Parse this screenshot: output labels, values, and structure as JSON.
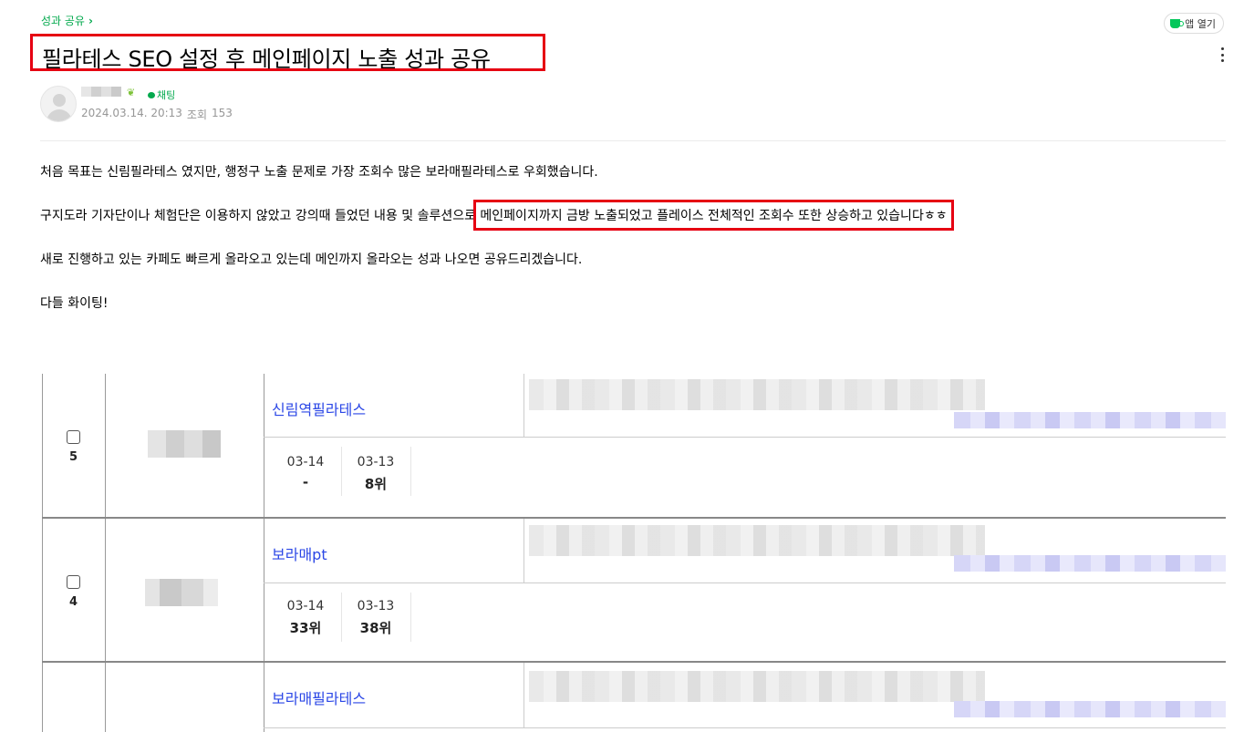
{
  "breadcrumb": {
    "label": "성과 공유"
  },
  "header": {
    "app_open_label": "앱 열기"
  },
  "post": {
    "title": "필라테스 SEO 설정 후 메인페이지 노출 성과 공유",
    "chat_label": "채팅",
    "date": "2024.03.14. 20:13",
    "views_label": "조회",
    "views": "153",
    "paragraphs": {
      "p1": "처음 목표는 신림필라테스 였지만, 행정구 노출 문제로 가장 조회수 많은 보라매필라테스로 우회했습니다.",
      "p2_before": "구지도라 기자단이나 체험단은 이용하지 않았고 강의때 들었던 내용 및 솔루션으로 ",
      "p2_highlight": "메인페이지까지 금방 노출되었고 플레이스 전체적인 조회수 또한 상승하고 있습니다ㅎㅎ",
      "p3": "새로 진행하고 있는 카페도 빠르게 올라오고 있는데 메인까지 올라오는 성과 나오면 공유드리겠습니다.",
      "p4": "다들 화이팅!"
    }
  },
  "table": {
    "rows": [
      {
        "rank": "5",
        "keyword": "신림역필라테스",
        "d1_label": "03-14",
        "d1_value": "-",
        "d2_label": "03-13",
        "d2_value": "8위"
      },
      {
        "rank": "4",
        "keyword": "보라매pt",
        "d1_label": "03-14",
        "d1_value": "33위",
        "d2_label": "03-13",
        "d2_value": "38위"
      },
      {
        "rank": "",
        "keyword": "보라매필라테스"
      }
    ]
  },
  "icons": {
    "chevron": "chevron-right-icon",
    "cup": "app-cup-icon",
    "more": "more-vertical-icon",
    "sprout": "sprout-icon",
    "chat": "chat-bubble-icon",
    "checkbox": "checkbox-icon"
  },
  "colors": {
    "accent_green": "#03a94d",
    "highlight_red": "#e60012",
    "link_blue": "#2b47e6"
  }
}
